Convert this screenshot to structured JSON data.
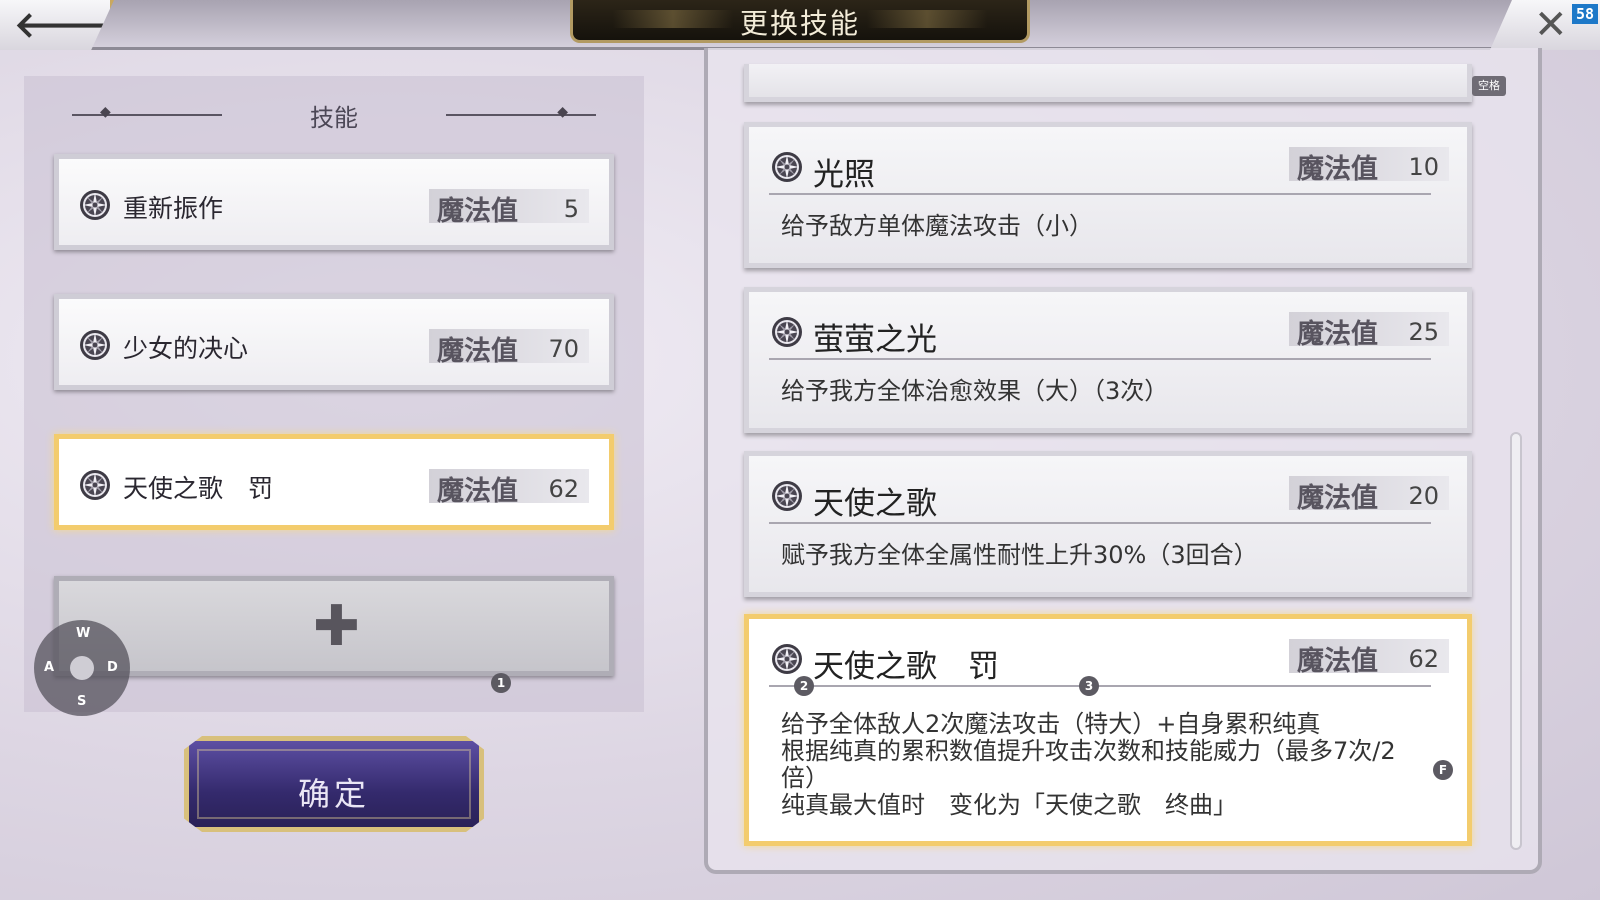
{
  "header": {
    "title": "更换技能",
    "back_icon": "arrow-left-icon",
    "close_icon": "close-x-icon",
    "fps_counter": "58"
  },
  "left": {
    "header": "技能",
    "mp_label": "魔法值",
    "equipped": [
      {
        "name": "重新振作",
        "mp": "5"
      },
      {
        "name": "少女的决心",
        "mp": "70"
      },
      {
        "name": "天使之歌　罚",
        "mp": "62",
        "selected": true
      }
    ],
    "add_slot_icon": "plus-icon",
    "confirm_label": "确定"
  },
  "controls": {
    "wasd": {
      "w": "W",
      "a": "A",
      "s": "S",
      "d": "D"
    },
    "badges": [
      "1",
      "2",
      "3",
      "F"
    ],
    "space_tag": "空格"
  },
  "right": {
    "mp_label": "魔法值",
    "skills": [
      {
        "name": "光照",
        "mp": "10",
        "desc": "给予敌方单体魔法攻击（小）"
      },
      {
        "name": "萤萤之光",
        "mp": "25",
        "desc": "给予我方全体治愈效果（大）（3次）"
      },
      {
        "name": "天使之歌",
        "mp": "20",
        "desc": "赋予我方全体全属性耐性上升30%（3回合）"
      },
      {
        "name": "天使之歌　罚",
        "mp": "62",
        "selected": true,
        "desc": "给予全体敌人2次魔法攻击（特大）+自身累积纯真\n根据纯真的累积数值提升攻击次数和技能威力（最多7次/2\n倍）\n纯真最大值时　变化为「天使之歌　终曲」"
      }
    ]
  },
  "colors": {
    "highlight": "#f3cc6d",
    "confirm_button": "#3b2f7a",
    "title_banner": "#1d1810"
  }
}
